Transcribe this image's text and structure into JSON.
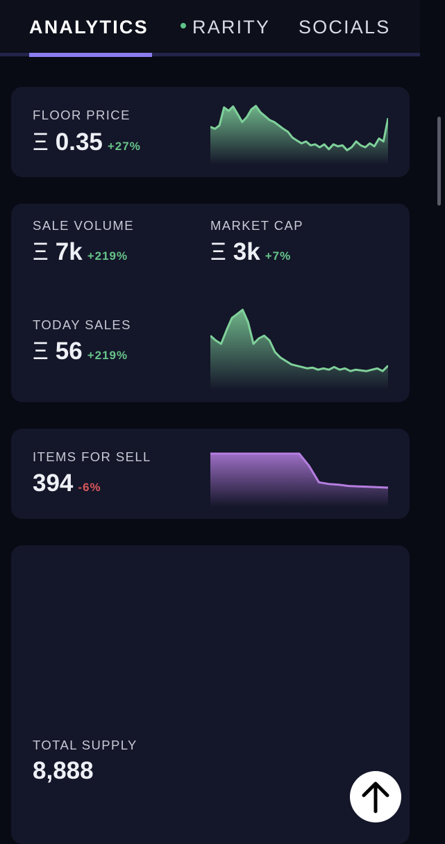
{
  "tabs": [
    {
      "label": "ANALYTICS",
      "active": true
    },
    {
      "label": "RARITY",
      "active": false,
      "indicator_color": "#5fc488"
    },
    {
      "label": "SOCIALS",
      "active": false
    }
  ],
  "currency_symbol": "Ξ",
  "floor_price": {
    "label": "FLOOR PRICE",
    "value": "0.35",
    "change": "+27%",
    "trend": [
      0.52,
      0.48,
      0.55,
      0.92,
      0.85,
      0.94,
      0.78,
      0.62,
      0.72,
      0.88,
      0.95,
      0.82,
      0.74,
      0.66,
      0.62,
      0.55,
      0.48,
      0.42,
      0.3,
      0.24,
      0.18,
      0.22,
      0.14,
      0.16,
      0.1,
      0.16,
      0.06,
      0.16,
      0.12,
      0.14,
      0.04,
      0.1,
      0.22,
      0.14,
      0.1,
      0.18,
      0.12,
      0.28,
      0.22,
      0.7
    ]
  },
  "sale_volume": {
    "label": "SALE VOLUME",
    "value": "7k",
    "change": "+219%"
  },
  "market_cap": {
    "label": "MARKET CAP",
    "value": "3k",
    "change": "+7%"
  },
  "today_sales": {
    "label": "TODAY SALES",
    "value": "56",
    "change": "+219%",
    "trend": [
      0.62,
      0.55,
      0.5,
      0.7,
      0.88,
      0.94,
      1.0,
      0.82,
      0.5,
      0.58,
      0.62,
      0.55,
      0.38,
      0.3,
      0.25,
      0.2,
      0.18,
      0.16,
      0.14,
      0.15,
      0.12,
      0.14,
      0.12,
      0.16,
      0.12,
      0.14,
      0.1,
      0.12,
      0.11,
      0.1,
      0.12,
      0.14,
      0.1,
      0.18
    ]
  },
  "items_for_sell": {
    "label": "ITEMS FOR SELL",
    "value": "394",
    "change": "-6%",
    "trend": [
      1.0,
      1.0,
      1.0,
      1.0,
      1.0,
      1.0,
      1.0,
      1.0,
      1.0,
      1.0,
      0.7,
      0.3,
      0.26,
      0.24,
      0.21,
      0.2,
      0.19,
      0.18,
      0.17
    ]
  },
  "total_supply": {
    "label": "TOTAL SUPPLY",
    "value": "8,888"
  },
  "colors": {
    "up": "#67c48a",
    "down": "#d8585a",
    "accent": "#8b7cf0",
    "purple_area": "#b57ee0",
    "green_area": "#7fd19a"
  },
  "icons": {
    "scroll_top": "arrow-up-icon"
  }
}
